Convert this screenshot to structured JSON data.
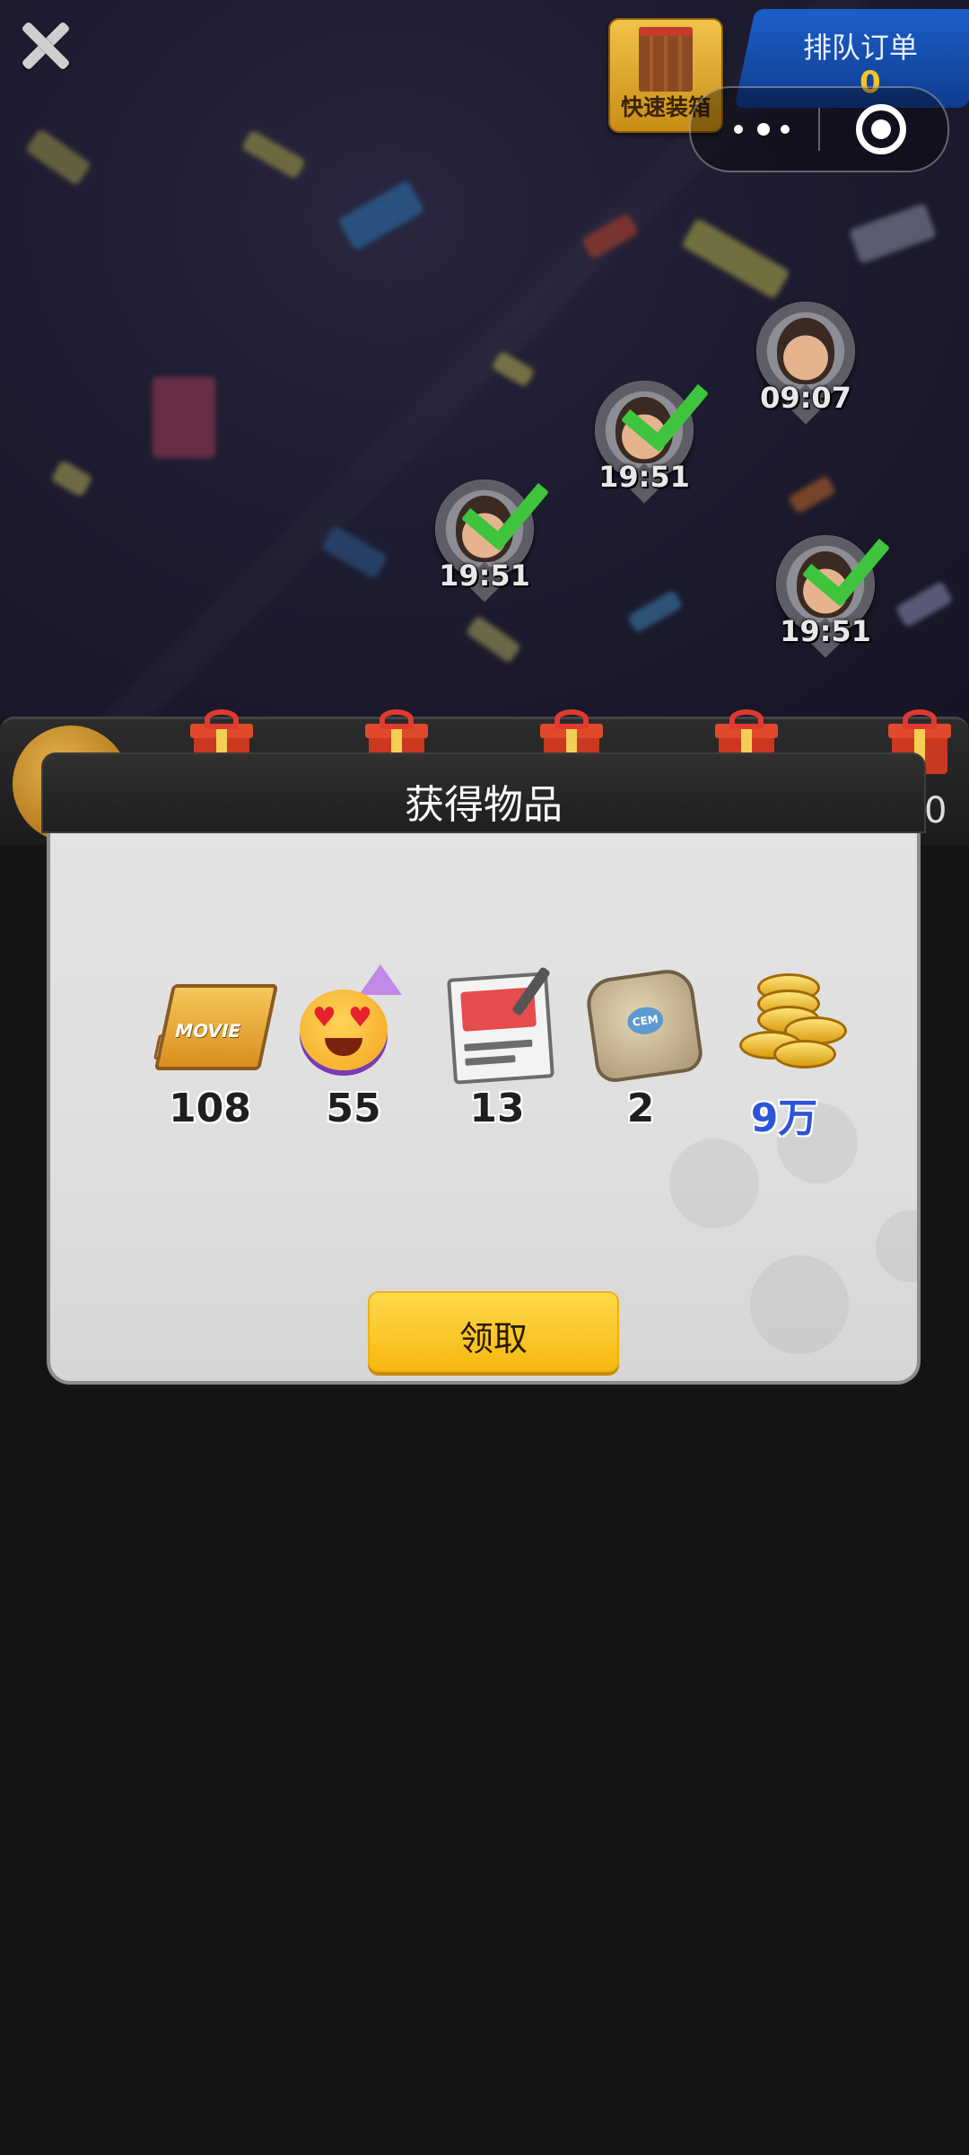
{
  "header": {
    "quick_pack_label": "快速装箱",
    "queue_title": "排队订单",
    "queue_count": "0"
  },
  "map": {
    "pins": [
      {
        "time": "09:07",
        "completed": false
      },
      {
        "time": "19:51",
        "completed": true
      },
      {
        "time": "19:51",
        "completed": true
      },
      {
        "time": "19:51",
        "completed": true
      }
    ]
  },
  "reward_strip": {
    "edge_text": "0"
  },
  "modal": {
    "title": "获得物品",
    "items": [
      {
        "icon": "movie-book-icon",
        "count": "108"
      },
      {
        "icon": "heart-eyes-emoji-icon",
        "count": "55"
      },
      {
        "icon": "ticket-card-icon",
        "count": "13"
      },
      {
        "icon": "cement-bag-icon",
        "count": "2"
      },
      {
        "icon": "gold-coins-icon",
        "count": "9万"
      }
    ],
    "movie_icon_text": "MOVIE",
    "cement_icon_text": "CEM",
    "claim_label": "领取"
  },
  "colors": {
    "accent_yellow": "#f7b90e",
    "check_green": "#3fc43d",
    "coins_count_blue": "#2b55d6"
  }
}
